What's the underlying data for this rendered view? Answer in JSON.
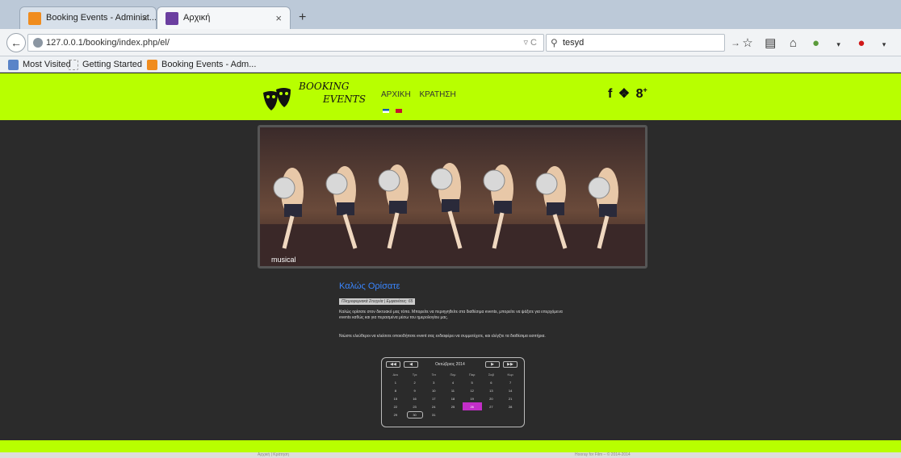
{
  "browser": {
    "tabs": [
      {
        "title": "Booking Events - Administ...",
        "close": "×"
      },
      {
        "title": "Αρχική",
        "close": "×"
      }
    ],
    "new_tab": "+",
    "url": "127.0.0.1/booking/index.php/el/",
    "search_query": "tesyd",
    "bookmarks": [
      "Most Visited",
      "Getting Started",
      "Booking Events - Adm..."
    ]
  },
  "site": {
    "logo": {
      "line1": "BOOKING",
      "line2": "EVENTS"
    },
    "menu": [
      "ΑΡΧΙΚΗ",
      "ΚΡΑΤΗΣΗ"
    ],
    "social": [
      "f",
      "t",
      "g+"
    ],
    "slide_caption": "musical",
    "welcome_title": "Καλώς Ορίσατε",
    "meta": "Πληροφοριακά Στοιχεία | Εμφανίσεις: 65",
    "paragraph1": "Καλώς ορίσατε στον δικτυακό μας τόπο. Μπορείτε να περιηγηθείτε στα διαθέσιμα events, μπορείτε να ψάξετε για επερχόμενα events καθώς και για περασμένα μέσω του ημερολογίου μας.",
    "paragraph2": "Νιώστε ελεύθεροι να κλείσετε οποιοδήποτε event σας ενδιαφέρει να συμμετέχετε, και ελέγξτε τα διαθέσιμα εισιτήρια.",
    "calendar": {
      "month": "Οκτώβριος 2014",
      "weekdays": [
        "Δευ",
        "Τρι",
        "Τετ",
        "Πεμ",
        "Παρ",
        "Σαβ",
        "Κυρ"
      ],
      "weeks": [
        [
          "1",
          "2",
          "3",
          "4",
          "5",
          "6",
          "7"
        ],
        [
          "8",
          "9",
          "10",
          "11",
          "12",
          "13",
          "14"
        ],
        [
          "15",
          "16",
          "17",
          "18",
          "19",
          "20",
          "21"
        ],
        [
          "22",
          "23",
          "24",
          "25",
          "26",
          "27",
          "28"
        ],
        [
          "29",
          "30",
          "31",
          "",
          "",
          "",
          ""
        ]
      ],
      "highlighted_day": "26",
      "today": "30"
    },
    "footer_links": "Αρχική | Κράτηση",
    "footer_copy": "Hooray for Film – © 2014-2014"
  },
  "colors": {
    "header_bg": "#b8ff00",
    "page_bg": "#2b2b2b",
    "link": "#3a86ff",
    "highlight": "#c22ec8"
  }
}
